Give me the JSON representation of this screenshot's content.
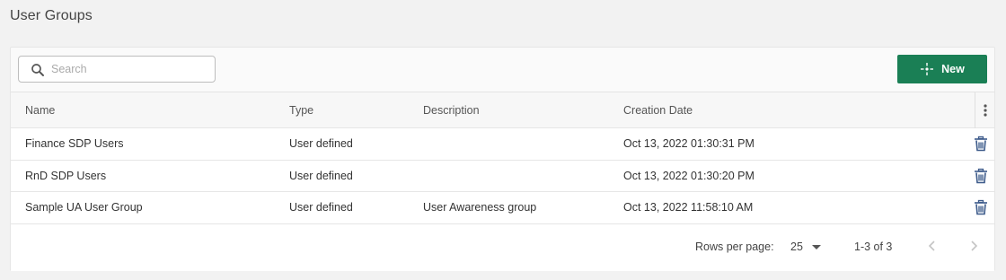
{
  "page": {
    "title": "User Groups"
  },
  "toolbar": {
    "search_placeholder": "Search",
    "search_value": "",
    "new_label": "New",
    "accent_color": "#1a7f55"
  },
  "table": {
    "columns": [
      "Name",
      "Type",
      "Description",
      "Creation Date"
    ],
    "rows": [
      {
        "name": "Finance SDP Users",
        "type": "User defined",
        "description": "",
        "created": "Oct 13, 2022 01:30:31 PM"
      },
      {
        "name": "RnD SDP Users",
        "type": "User defined",
        "description": "",
        "created": "Oct 13, 2022 01:30:20 PM"
      },
      {
        "name": "Sample UA User Group",
        "type": "User defined",
        "description": "User Awareness group",
        "created": "Oct 13, 2022 11:58:10 AM"
      }
    ],
    "row_action_icon": "trash-icon",
    "column_menu_icon": "kebab-menu-icon"
  },
  "pagination": {
    "rows_per_page_label": "Rows per page:",
    "rows_per_page_value": "25",
    "range_text": "1-3 of 3"
  }
}
